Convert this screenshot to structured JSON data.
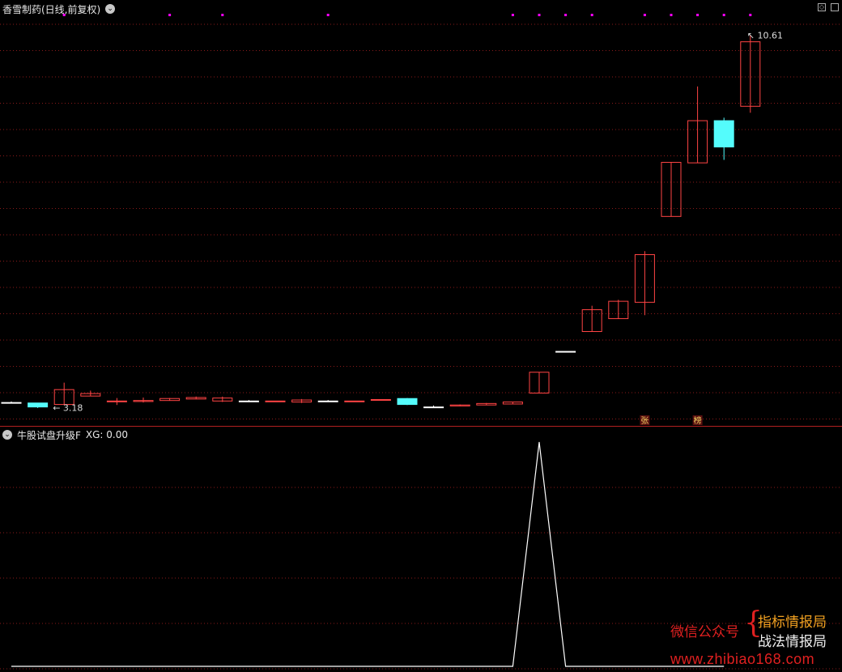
{
  "header": {
    "title": "香雪制药(日线,前复权)"
  },
  "indicator": {
    "title": "牛股试盘升级F",
    "value_label": "XG: 0.00"
  },
  "annotations": {
    "low_label": "3.18",
    "high_label": "10.61",
    "tag_zhang": "张",
    "tag_bang": "榜"
  },
  "watermark": {
    "left_text": "微信公众号",
    "brace": "{",
    "right_line1": "指标情报局",
    "right_line2": "战法情报局",
    "url": "www.zhibiao168.com"
  },
  "colors": {
    "up": "#ff4444",
    "down": "#54fcfc",
    "flat": "#ffffff",
    "grid": "#8a1a1a",
    "marker": "#ff00ff",
    "indicator_line": "#ffffff",
    "panel_border": "#b02020"
  },
  "chart_data": [
    {
      "type": "candlestick",
      "title": "香雪制药(日线,前复权)",
      "ylim": [
        3.0,
        10.8
      ],
      "grid": true,
      "candles": [
        {
          "o": 3.21,
          "h": 3.23,
          "l": 3.19,
          "c": 3.21
        },
        {
          "o": 3.2,
          "h": 3.2,
          "l": 3.1,
          "c": 3.12
        },
        {
          "o": 3.17,
          "h": 3.61,
          "l": 3.17,
          "c": 3.47
        },
        {
          "o": 3.34,
          "h": 3.45,
          "l": 3.34,
          "c": 3.39
        },
        {
          "o": 3.23,
          "h": 3.3,
          "l": 3.16,
          "c": 3.24
        },
        {
          "o": 3.23,
          "h": 3.31,
          "l": 3.21,
          "c": 3.25
        },
        {
          "o": 3.25,
          "h": 3.3,
          "l": 3.25,
          "c": 3.29
        },
        {
          "o": 3.28,
          "h": 3.33,
          "l": 3.28,
          "c": 3.31
        },
        {
          "o": 3.24,
          "h": 3.33,
          "l": 3.22,
          "c": 3.3
        },
        {
          "o": 3.24,
          "h": 3.26,
          "l": 3.22,
          "c": 3.24
        },
        {
          "o": 3.23,
          "h": 3.24,
          "l": 3.22,
          "c": 3.24
        },
        {
          "o": 3.22,
          "h": 3.28,
          "l": 3.2,
          "c": 3.26
        },
        {
          "o": 3.24,
          "h": 3.26,
          "l": 3.23,
          "c": 3.24
        },
        {
          "o": 3.23,
          "h": 3.24,
          "l": 3.23,
          "c": 3.24
        },
        {
          "o": 3.26,
          "h": 3.27,
          "l": 3.26,
          "c": 3.27
        },
        {
          "o": 3.29,
          "h": 3.3,
          "l": 3.16,
          "c": 3.17
        },
        {
          "o": 3.12,
          "h": 3.15,
          "l": 3.11,
          "c": 3.12
        },
        {
          "o": 3.14,
          "h": 3.17,
          "l": 3.14,
          "c": 3.16
        },
        {
          "o": 3.16,
          "h": 3.2,
          "l": 3.16,
          "c": 3.19
        },
        {
          "o": 3.18,
          "h": 3.22,
          "l": 3.18,
          "c": 3.22
        },
        {
          "o": 3.4,
          "h": 3.82,
          "l": 3.4,
          "c": 3.82
        },
        {
          "o": 4.24,
          "h": 4.24,
          "l": 4.24,
          "c": 4.24
        },
        {
          "o": 4.64,
          "h": 5.16,
          "l": 4.64,
          "c": 5.08
        },
        {
          "o": 4.9,
          "h": 5.28,
          "l": 4.9,
          "c": 5.25
        },
        {
          "o": 5.23,
          "h": 6.26,
          "l": 4.97,
          "c": 6.19
        },
        {
          "o": 6.96,
          "h": 8.05,
          "l": 6.96,
          "c": 8.05
        },
        {
          "o": 8.04,
          "h": 9.58,
          "l": 8.04,
          "c": 8.89
        },
        {
          "o": 8.89,
          "h": 8.95,
          "l": 8.1,
          "c": 8.36
        },
        {
          "o": 9.18,
          "h": 10.61,
          "l": 9.05,
          "c": 10.48
        }
      ],
      "highlight_markers_at_index": [
        2,
        6,
        8,
        12,
        19,
        20,
        21,
        22,
        24,
        25,
        26,
        27,
        28
      ]
    },
    {
      "type": "line",
      "title": "牛股试盘升级F",
      "series": [
        {
          "name": "XG",
          "values": [
            0,
            0,
            0,
            0,
            0,
            0,
            0,
            0,
            0,
            0,
            0,
            0,
            0,
            0,
            0,
            0,
            0,
            0,
            0,
            0,
            1,
            0,
            0,
            0,
            0,
            0,
            0,
            0
          ]
        }
      ],
      "ylim": [
        0,
        1.0
      ],
      "grid": true
    }
  ]
}
